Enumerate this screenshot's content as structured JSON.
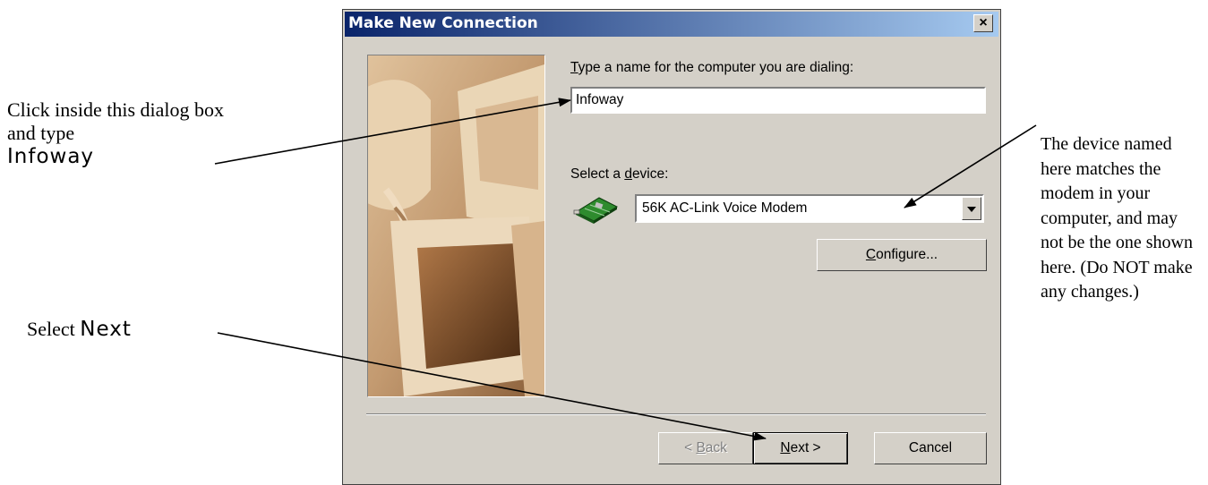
{
  "annotations": {
    "click_text": "Click inside this dialog box and type",
    "click_value": "Infoway",
    "select_text": "Select",
    "select_value": "Next",
    "device_note": "The device named  here matches the modem in your computer, and may not be the one shown here.  (Do NOT make any changes.)"
  },
  "dialog": {
    "title": "Make New Connection",
    "close_glyph": "×",
    "name_label_key": "T",
    "name_label_rest": "ype a name for the computer you are dialing:",
    "name_value": "Infoway",
    "device_label_pre": "Select a ",
    "device_label_key": "d",
    "device_label_post": "evice:",
    "device_value": "56K AC-Link Voice Modem",
    "configure_key": "C",
    "configure_rest": "onfigure...",
    "back_pre": "< ",
    "back_key": "B",
    "back_rest": "ack",
    "next_key": "N",
    "next_rest": "ext >",
    "cancel": "Cancel"
  },
  "icons": {
    "modem": "modem-icon",
    "dropdown": "chevron-down-icon",
    "close": "close-icon"
  },
  "colors": {
    "titlebar_start": "#0a246a",
    "titlebar_end": "#a6caf0",
    "dialog_face": "#d4d0c8",
    "wizard_image": "#c9a27a"
  }
}
